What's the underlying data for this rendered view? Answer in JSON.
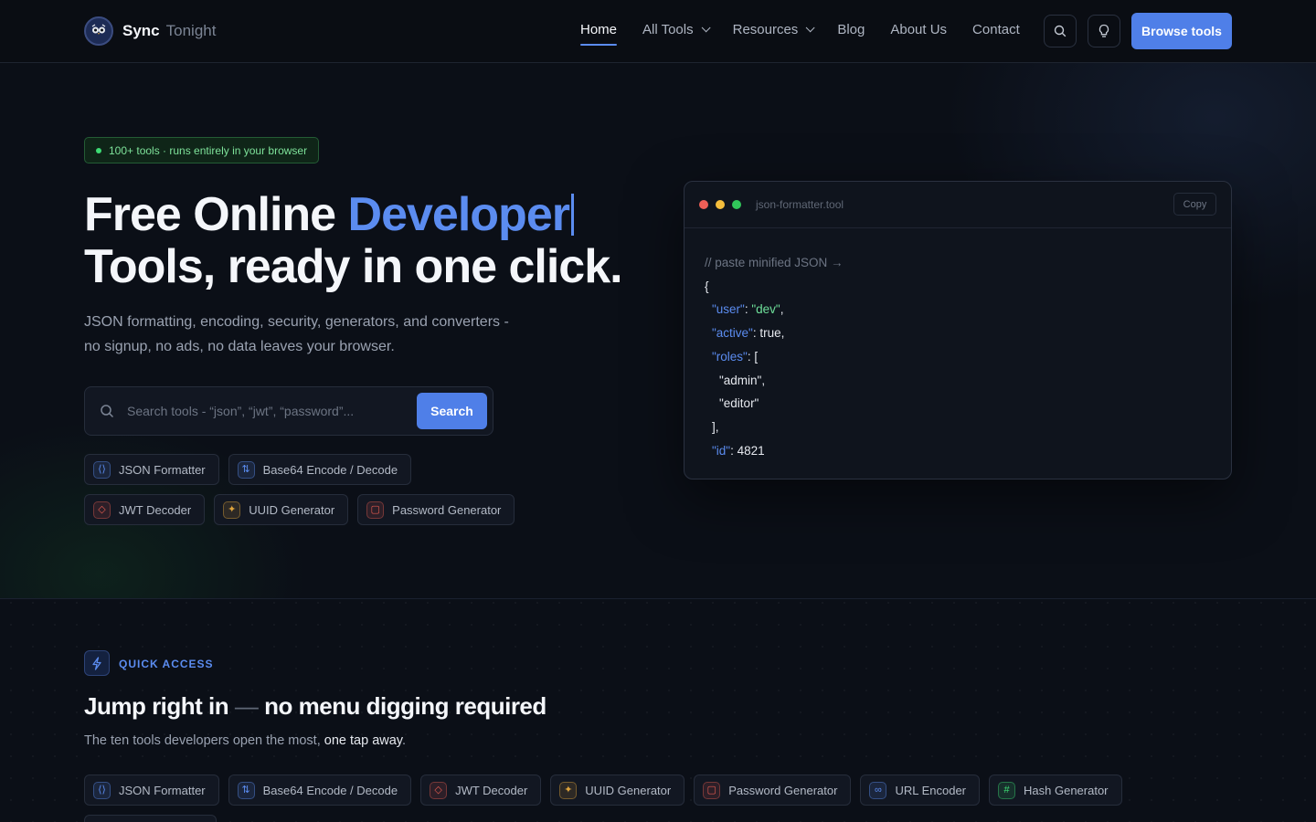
{
  "nav": {
    "brand": "Sync",
    "brand_suffix": "Tonight",
    "links": [
      {
        "label": "Home",
        "active": true,
        "dropdown": false
      },
      {
        "label": "All Tools",
        "active": false,
        "dropdown": true
      },
      {
        "label": "Resources",
        "active": false,
        "dropdown": true
      },
      {
        "label": "Blog",
        "active": false,
        "dropdown": false
      },
      {
        "label": "About Us",
        "active": false,
        "dropdown": false
      },
      {
        "label": "Contact",
        "active": false,
        "dropdown": false
      }
    ],
    "cta": "Browse tools"
  },
  "hero": {
    "badge": "100+ tools · runs entirely in your browser",
    "title_part1": "Free Online ",
    "title_accent": "Developer",
    "title_part2": "Tools, ready in one click.",
    "subtitle": "JSON formatting, encoding, security, generators, and converters - no signup, no ads, no data leaves your browser.",
    "search_placeholder": "Search tools - “json”, “jwt”, “password”...",
    "search_button": "Search",
    "chips": [
      {
        "label": "JSON Formatter",
        "glyph": "⟨⟩",
        "color": "#5b8cf0"
      },
      {
        "label": "Base64 Encode / Decode",
        "glyph": "⇅",
        "color": "#5b8cf0"
      },
      {
        "label": "JWT Decoder",
        "glyph": "◇",
        "color": "#e05a4f"
      },
      {
        "label": "UUID Generator",
        "glyph": "✦",
        "color": "#e0a53d"
      },
      {
        "label": "Password Generator",
        "glyph": "▢",
        "color": "#e05a4f"
      }
    ]
  },
  "code_window": {
    "filename": "json-formatter.tool",
    "copy_label": "Copy",
    "comment": "// paste minified JSON →",
    "lines": [
      {
        "indent": 0,
        "parts": [
          {
            "t": "{",
            "c": ""
          }
        ]
      },
      {
        "indent": 1,
        "parts": [
          {
            "t": "\"user\"",
            "c": "k"
          },
          {
            "t": ": ",
            "c": ""
          },
          {
            "t": "\"dev\"",
            "c": "s"
          },
          {
            "t": ",",
            "c": ""
          }
        ]
      },
      {
        "indent": 1,
        "parts": [
          {
            "t": "\"active\"",
            "c": "k"
          },
          {
            "t": ": true,",
            "c": ""
          }
        ]
      },
      {
        "indent": 1,
        "parts": [
          {
            "t": "\"roles\"",
            "c": "k"
          },
          {
            "t": ": [",
            "c": ""
          }
        ]
      },
      {
        "indent": 2,
        "parts": [
          {
            "t": "\"admin\",",
            "c": ""
          }
        ]
      },
      {
        "indent": 2,
        "parts": [
          {
            "t": "\"editor\"",
            "c": ""
          }
        ]
      },
      {
        "indent": 1,
        "parts": [
          {
            "t": "],",
            "c": ""
          }
        ]
      },
      {
        "indent": 1,
        "parts": [
          {
            "t": "\"id\"",
            "c": "k"
          },
          {
            "t": ": 4821",
            "c": ""
          }
        ]
      }
    ]
  },
  "quick_access": {
    "label": "QUICK ACCESS",
    "title_part1": "Jump right in ",
    "title_dash": "—",
    "title_part2": " no menu digging required",
    "subtitle_part1": "The ten tools developers open the most, ",
    "subtitle_highlight": "one tap away",
    "subtitle_part2": ".",
    "chips": [
      {
        "label": "JSON Formatter",
        "glyph": "⟨⟩",
        "color": "#5b8cf0"
      },
      {
        "label": "Base64 Encode / Decode",
        "glyph": "⇅",
        "color": "#5b8cf0"
      },
      {
        "label": "JWT Decoder",
        "glyph": "◇",
        "color": "#e05a4f"
      },
      {
        "label": "UUID Generator",
        "glyph": "✦",
        "color": "#e0a53d"
      },
      {
        "label": "Password Generator",
        "glyph": "▢",
        "color": "#e05a4f"
      },
      {
        "label": "URL Encoder",
        "glyph": "∞",
        "color": "#5b8cf0"
      },
      {
        "label": "Hash Generator",
        "glyph": "#",
        "color": "#3ddc74"
      },
      {
        "label": "Color Converter",
        "glyph": "◎",
        "color": "#e0a53d"
      }
    ]
  },
  "colors": {
    "accent": "#4f7fe8",
    "badge_green": "#7ee29a"
  }
}
